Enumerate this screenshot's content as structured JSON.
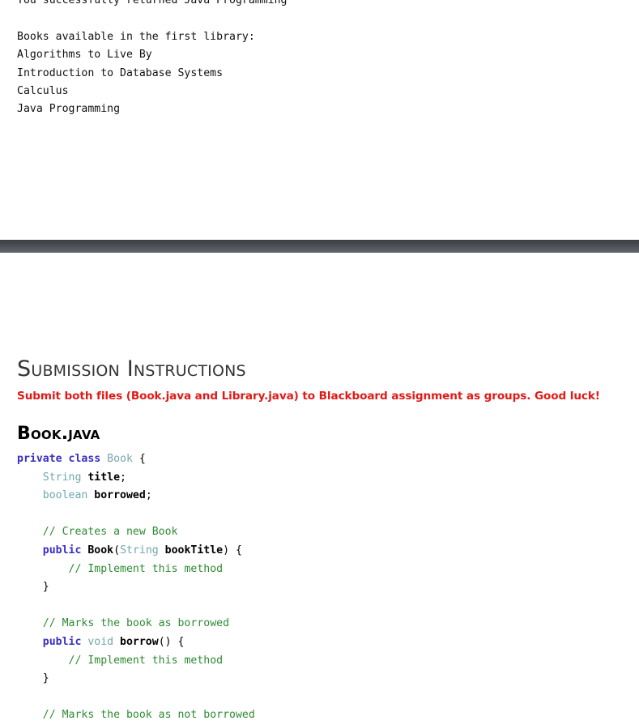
{
  "console": {
    "lines": [
      "You successfully returned Java Programming",
      "",
      "Books available in the first library:",
      "Algorithms to Live By",
      "Introduction to Database Systems",
      "Calculus",
      "Java Programming"
    ]
  },
  "divider": {
    "color_top": "#3b3e42",
    "color_bottom": "#6a6e72"
  },
  "sections": {
    "submission_heading": "Submission Instructions",
    "submission_note": "Submit both files (Book.java and Library.java) to Blackboard assignment as groups. Good luck!",
    "note_color": "#e01b17",
    "file_heading": "Book.java"
  },
  "code": {
    "language": "java",
    "colors": {
      "keyword": "#3a2fc4",
      "type": "#6fa8ac",
      "identifier": "#000000",
      "comment": "#2e8b33",
      "plain": "#000000"
    },
    "lines": [
      {
        "indent": 0,
        "tokens": [
          {
            "t": "kw",
            "s": "private class "
          },
          {
            "t": "cls",
            "s": "Book"
          },
          {
            "t": "plain",
            "s": " {"
          }
        ]
      },
      {
        "indent": 1,
        "tokens": [
          {
            "t": "type",
            "s": "String "
          },
          {
            "t": "ident",
            "s": "title"
          },
          {
            "t": "plain",
            "s": ";"
          }
        ]
      },
      {
        "indent": 1,
        "tokens": [
          {
            "t": "type",
            "s": "boolean "
          },
          {
            "t": "ident",
            "s": "borrowed"
          },
          {
            "t": "plain",
            "s": ";"
          }
        ]
      },
      {
        "indent": 0,
        "tokens": []
      },
      {
        "indent": 1,
        "tokens": [
          {
            "t": "comment",
            "s": "// Creates a new Book"
          }
        ]
      },
      {
        "indent": 1,
        "tokens": [
          {
            "t": "kw",
            "s": "public "
          },
          {
            "t": "ident",
            "s": "Book"
          },
          {
            "t": "plain",
            "s": "("
          },
          {
            "t": "type",
            "s": "String "
          },
          {
            "t": "ident",
            "s": "bookTitle"
          },
          {
            "t": "plain",
            "s": ") {"
          }
        ]
      },
      {
        "indent": 2,
        "tokens": [
          {
            "t": "comment",
            "s": "// Implement this method"
          }
        ]
      },
      {
        "indent": 1,
        "tokens": [
          {
            "t": "plain",
            "s": "}"
          }
        ]
      },
      {
        "indent": 0,
        "tokens": []
      },
      {
        "indent": 1,
        "tokens": [
          {
            "t": "comment",
            "s": "// Marks the book as borrowed"
          }
        ]
      },
      {
        "indent": 1,
        "tokens": [
          {
            "t": "kw",
            "s": "public "
          },
          {
            "t": "type",
            "s": "void "
          },
          {
            "t": "ident",
            "s": "borrow"
          },
          {
            "t": "plain",
            "s": "() {"
          }
        ]
      },
      {
        "indent": 2,
        "tokens": [
          {
            "t": "comment",
            "s": "// Implement this method"
          }
        ]
      },
      {
        "indent": 1,
        "tokens": [
          {
            "t": "plain",
            "s": "}"
          }
        ]
      },
      {
        "indent": 0,
        "tokens": []
      },
      {
        "indent": 1,
        "tokens": [
          {
            "t": "comment",
            "s": "// Marks the book as not borrowed"
          }
        ]
      }
    ]
  }
}
